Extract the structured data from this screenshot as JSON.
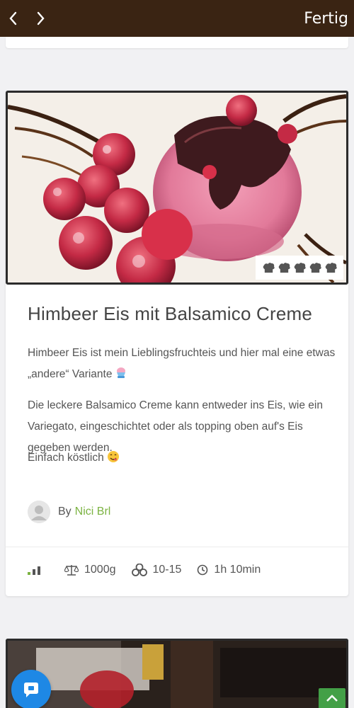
{
  "topbar": {
    "back_icon": "chevron-left-icon",
    "forward_icon": "chevron-right-icon",
    "done_label": "Fertig"
  },
  "recipe": {
    "title": "Himbeer Eis mit Balsamico Creme",
    "paragraph1": "Himbeer Eis ist mein Lieblingsfruchteis und hier mal eine etwas „andere“ Variante",
    "paragraph2": "Die leckere Balsamico Creme kann entweder ins Eis, wie ein Variegato, eingeschichtet oder als topping oben auf's Eis gegeben werden.",
    "paragraph3": "Einfach köstlich",
    "author_prefix": "By",
    "author_name": "Nici Brl",
    "rating_icon": "chef-hat-icon",
    "rating_max": 5,
    "weight": "1000g",
    "servings": "10-15",
    "time": "1h 10min",
    "difficulty_icon": "difficulty-bars-icon"
  },
  "colors": {
    "topbar": "#3a2413",
    "author_link": "#7cb342",
    "chat_button": "#1e88e5",
    "scroll_top": "#43a047"
  }
}
